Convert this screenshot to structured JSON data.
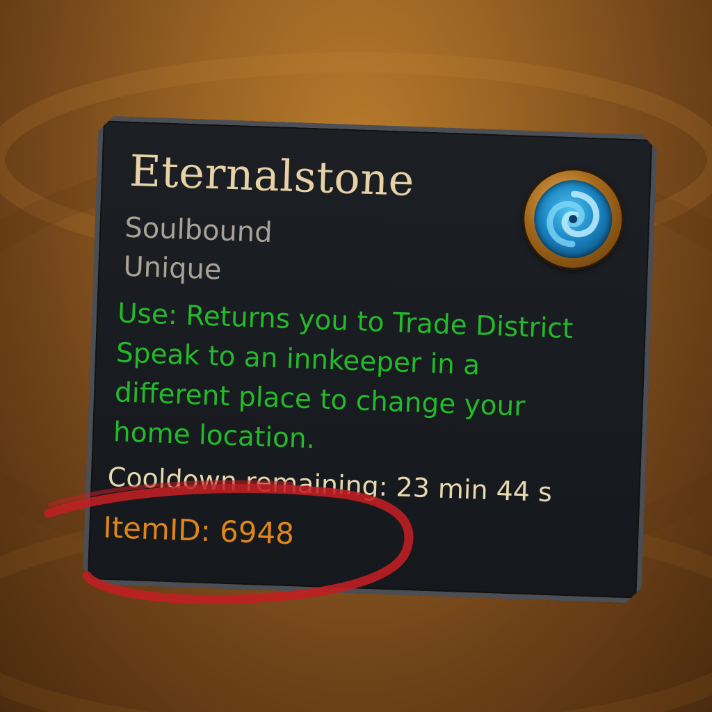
{
  "tooltip": {
    "title": "Eternalstone",
    "binding": "Soulbound",
    "unique": "Unique",
    "use_line_1": "Use: Returns you to Trade District",
    "use_line_2": "Speak to an innkeeper in a",
    "use_line_3": "different place to change your",
    "use_line_4": "home location.",
    "cooldown": "Cooldown remaining: 23 min 44 s",
    "item_id": "ItemID: 6948",
    "icon": "swirl-hearthstone-icon"
  },
  "colors": {
    "title": "#e6d2a6",
    "binding": "#a8a294",
    "use_text": "#24b92a",
    "cooldown": "#e8d8b0",
    "item_id": "#df8619",
    "annotation": "#c21f22",
    "panel": "#1a1d21",
    "background": "#9a6424"
  },
  "annotation": {
    "type": "hand-drawn-ellipse",
    "target": "item-id"
  }
}
